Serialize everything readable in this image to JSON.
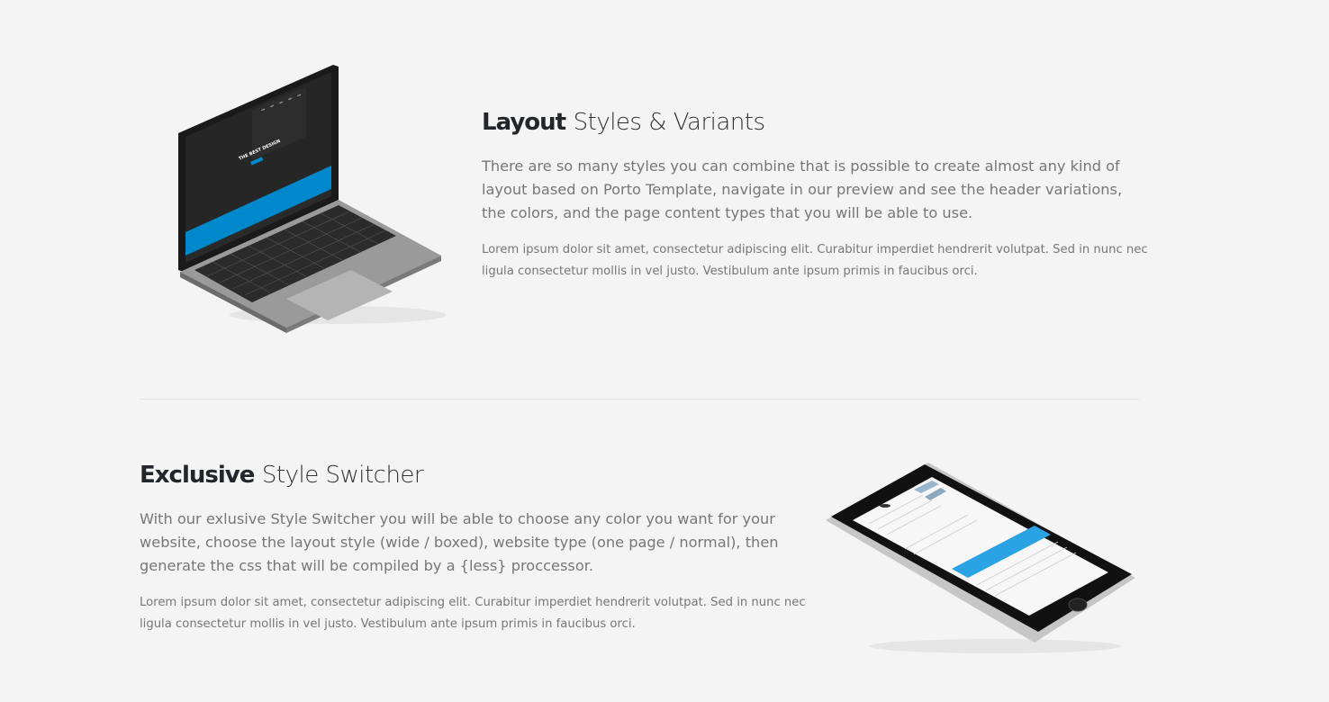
{
  "sections": [
    {
      "title_strong": "Layout",
      "title_rest": "Styles & Variants",
      "lead": "There are so many styles you can combine that is possible to create almost any kind of layout based on Porto Template, navigate in our preview and see the header variations, the colors, and the page content types that you will be able to use.",
      "body": "Lorem ipsum dolor sit amet, consectetur adipiscing elit. Curabitur imperdiet hendrerit volutpat. Sed in nunc nec ligula consectetur mollis in vel justo. Vestibulum ante ipsum primis in faucibus orci."
    },
    {
      "title_strong": "Exclusive",
      "title_rest": "Style Switcher",
      "lead": "With our exlusive Style Switcher you will be able to choose any color you want for your website, choose the layout style (wide / boxed), website type (one page / normal), then generate the css that will be compiled by a {less} proccessor.",
      "body": "Lorem ipsum dolor sit amet, consectetur adipiscing elit. Curabitur imperdiet hendrerit volutpat. Sed in nunc nec ligula consectetur mollis in vel justo. Vestibulum ante ipsum primis in faucibus orci."
    }
  ],
  "laptop_screen_text": {
    "headline": "THE BEST DESIGN"
  },
  "colors": {
    "accent": "#0088cc",
    "background": "#f4f4f4",
    "heading": "#222529",
    "text": "#777777"
  }
}
